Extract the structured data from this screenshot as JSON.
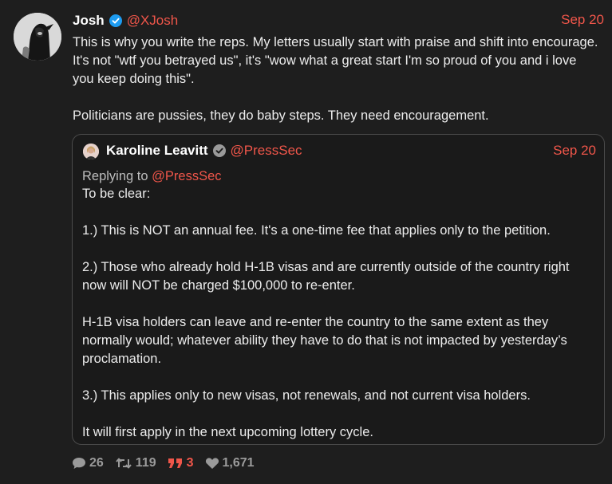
{
  "tweet": {
    "author": {
      "name": "Josh",
      "handle": "@XJosh",
      "verified": true,
      "avatar_icon": "hooded-figure-avatar"
    },
    "date": "Sep 20",
    "paragraphs": [
      "This is why you write the reps. My letters usually start with praise and shift into encourage. It's not \"wtf you betrayed us\", it's \"wow what a great start I'm so proud of you and i love you keep doing this\".",
      "Politicians are pussies, they do baby steps. They need encouragement."
    ],
    "quoted": {
      "author": {
        "name": "Karoline Leavitt",
        "handle": "@PressSec",
        "badge": "gray-verified-icon",
        "avatar_icon": "person-avatar"
      },
      "date": "Sep 20",
      "replying_label": "Replying to",
      "replying_to": "@PressSec",
      "paragraphs": [
        "To be clear:",
        "1.) This is NOT an annual fee. It's a one-time fee that applies only to the petition.",
        "2.) Those who already hold H-1B visas and are currently outside of the country right now will NOT be charged $100,000 to re-enter.",
        "H-1B visa holders can leave and re-enter the country to the same extent as they normally would; whatever ability they have to do that is not impacted by yesterday’s proclamation.",
        "3.) This applies only to new visas, not renewals, and not current visa holders.",
        "It will first apply in the next upcoming lottery cycle."
      ]
    },
    "stats": {
      "replies": "26",
      "retweets": "119",
      "quotes": "3",
      "likes": "1,671"
    },
    "colors": {
      "accent": "#f0564a",
      "background": "#1e1e1e",
      "muted": "#9a9a9a",
      "verified": "#1d9bf0"
    }
  }
}
